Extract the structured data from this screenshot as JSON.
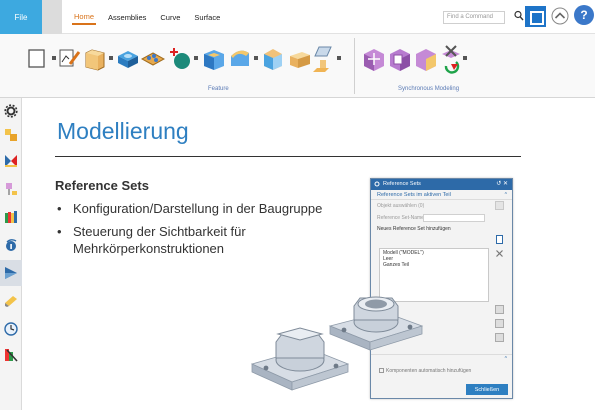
{
  "menubar": {
    "file_label": "File",
    "tabs": [
      {
        "label": "Home",
        "active": true
      },
      {
        "label": "Assemblies",
        "active": false
      },
      {
        "label": "Curve",
        "active": false
      },
      {
        "label": "Surface",
        "active": false
      }
    ],
    "command_finder_placeholder": "Find a Command",
    "accent": "#d9731a",
    "file_color": "#3da9e0"
  },
  "ribbon": {
    "groups": [
      {
        "label": "Feature"
      },
      {
        "label": "Synchronous Modeling"
      }
    ]
  },
  "slide": {
    "title": "Modellierung",
    "subheading": "Reference Sets",
    "bullets": [
      "Konfiguration/Darstellung in der Baugruppe",
      "Steuerung der Sichtbarkeit für Mehrkörperkonstruktionen"
    ],
    "title_color": "#2e7fc1"
  },
  "dialog": {
    "title": "Reference Sets",
    "section_title": "Reference Sets im aktiven Teil",
    "select_object_label": "Objekt auswählen (0)",
    "set_name_label": "Reference Set-Name",
    "add_new_label": "Neues Reference Set hinzufügen",
    "list_items": [
      "Modell (\"MODEL\")",
      "Leer",
      "Ganzes Teil"
    ],
    "add_components_label": "Komponenten automatisch hinzufügen",
    "close_label": "Schließen",
    "title_color": "#2d6aa8"
  }
}
